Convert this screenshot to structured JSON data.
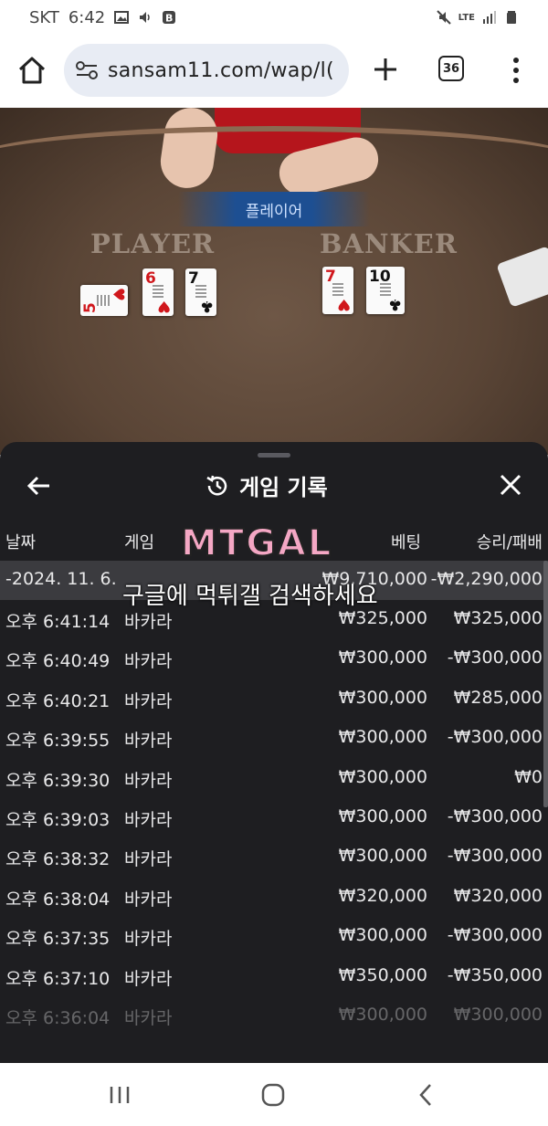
{
  "status_bar": {
    "carrier": "SKT",
    "time": "6:42",
    "network": "LTE",
    "icons": [
      "gallery-icon",
      "volume-icon",
      "b-app-icon",
      "mute-icon",
      "signal-icon",
      "battery-icon"
    ]
  },
  "browser": {
    "url": "sansam11.com/wap/l(",
    "tab_count": "36"
  },
  "game": {
    "status_banner": "플레이어",
    "player_label": "PLAYER",
    "banker_label": "BANKER",
    "player_cards": [
      "5♥",
      "6♥",
      "7♣"
    ],
    "banker_cards": [
      "7♥",
      "10♣"
    ]
  },
  "history": {
    "title": "게임 기록",
    "columns": {
      "date": "날짜",
      "game": "게임",
      "bet": "베팅",
      "winloss": "승리/패배"
    },
    "summary": {
      "date": "-2024. 11. 6.",
      "bet": "₩9,710,000",
      "winloss": "-₩2,290,000"
    },
    "rows": [
      {
        "time": "오후 6:41:14",
        "game": "바카라",
        "bet": "₩325,000",
        "winloss": "₩325,000"
      },
      {
        "time": "오후 6:40:49",
        "game": "바카라",
        "bet": "₩300,000",
        "winloss": "-₩300,000"
      },
      {
        "time": "오후 6:40:21",
        "game": "바카라",
        "bet": "₩300,000",
        "winloss": "₩285,000"
      },
      {
        "time": "오후 6:39:55",
        "game": "바카라",
        "bet": "₩300,000",
        "winloss": "-₩300,000"
      },
      {
        "time": "오후 6:39:30",
        "game": "바카라",
        "bet": "₩300,000",
        "winloss": "₩0"
      },
      {
        "time": "오후 6:39:03",
        "game": "바카라",
        "bet": "₩300,000",
        "winloss": "-₩300,000"
      },
      {
        "time": "오후 6:38:32",
        "game": "바카라",
        "bet": "₩300,000",
        "winloss": "-₩300,000"
      },
      {
        "time": "오후 6:38:04",
        "game": "바카라",
        "bet": "₩320,000",
        "winloss": "₩320,000"
      },
      {
        "time": "오후 6:37:35",
        "game": "바카라",
        "bet": "₩300,000",
        "winloss": "-₩300,000"
      },
      {
        "time": "오후 6:37:10",
        "game": "바카라",
        "bet": "₩350,000",
        "winloss": "-₩350,000"
      },
      {
        "time": "오후 6:36:04",
        "game": "바카라",
        "bet": "₩300,000",
        "winloss": "₩300,000"
      }
    ]
  },
  "watermark": {
    "logo": "MTGAL",
    "text": "구글에 먹튀갤 검색하세요"
  },
  "colors": {
    "sheet_bg": "#1e1e21",
    "summary_row_bg": "#3b3b3f",
    "banner_blue": "#1d4f92",
    "dealer_red": "#b5151c"
  }
}
